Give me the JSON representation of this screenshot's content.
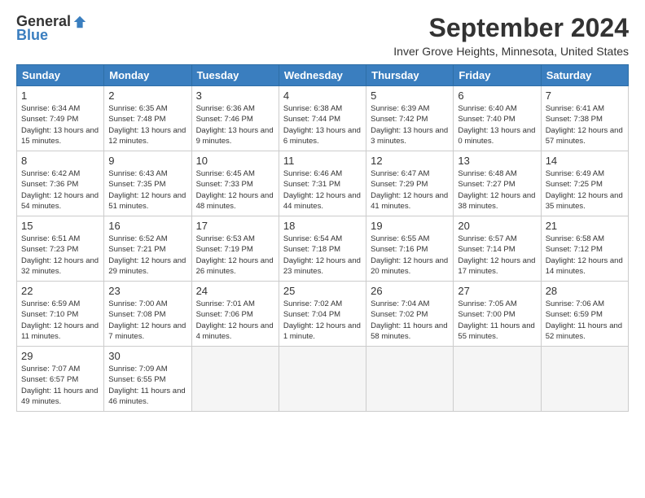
{
  "header": {
    "logo": {
      "general": "General",
      "blue": "Blue"
    },
    "title": "September 2024",
    "location": "Inver Grove Heights, Minnesota, United States"
  },
  "calendar": {
    "weekdays": [
      "Sunday",
      "Monday",
      "Tuesday",
      "Wednesday",
      "Thursday",
      "Friday",
      "Saturday"
    ],
    "weeks": [
      [
        {
          "day": "1",
          "sunrise": "Sunrise: 6:34 AM",
          "sunset": "Sunset: 7:49 PM",
          "daylight": "Daylight: 13 hours and 15 minutes."
        },
        {
          "day": "2",
          "sunrise": "Sunrise: 6:35 AM",
          "sunset": "Sunset: 7:48 PM",
          "daylight": "Daylight: 13 hours and 12 minutes."
        },
        {
          "day": "3",
          "sunrise": "Sunrise: 6:36 AM",
          "sunset": "Sunset: 7:46 PM",
          "daylight": "Daylight: 13 hours and 9 minutes."
        },
        {
          "day": "4",
          "sunrise": "Sunrise: 6:38 AM",
          "sunset": "Sunset: 7:44 PM",
          "daylight": "Daylight: 13 hours and 6 minutes."
        },
        {
          "day": "5",
          "sunrise": "Sunrise: 6:39 AM",
          "sunset": "Sunset: 7:42 PM",
          "daylight": "Daylight: 13 hours and 3 minutes."
        },
        {
          "day": "6",
          "sunrise": "Sunrise: 6:40 AM",
          "sunset": "Sunset: 7:40 PM",
          "daylight": "Daylight: 13 hours and 0 minutes."
        },
        {
          "day": "7",
          "sunrise": "Sunrise: 6:41 AM",
          "sunset": "Sunset: 7:38 PM",
          "daylight": "Daylight: 12 hours and 57 minutes."
        }
      ],
      [
        {
          "day": "8",
          "sunrise": "Sunrise: 6:42 AM",
          "sunset": "Sunset: 7:36 PM",
          "daylight": "Daylight: 12 hours and 54 minutes."
        },
        {
          "day": "9",
          "sunrise": "Sunrise: 6:43 AM",
          "sunset": "Sunset: 7:35 PM",
          "daylight": "Daylight: 12 hours and 51 minutes."
        },
        {
          "day": "10",
          "sunrise": "Sunrise: 6:45 AM",
          "sunset": "Sunset: 7:33 PM",
          "daylight": "Daylight: 12 hours and 48 minutes."
        },
        {
          "day": "11",
          "sunrise": "Sunrise: 6:46 AM",
          "sunset": "Sunset: 7:31 PM",
          "daylight": "Daylight: 12 hours and 44 minutes."
        },
        {
          "day": "12",
          "sunrise": "Sunrise: 6:47 AM",
          "sunset": "Sunset: 7:29 PM",
          "daylight": "Daylight: 12 hours and 41 minutes."
        },
        {
          "day": "13",
          "sunrise": "Sunrise: 6:48 AM",
          "sunset": "Sunset: 7:27 PM",
          "daylight": "Daylight: 12 hours and 38 minutes."
        },
        {
          "day": "14",
          "sunrise": "Sunrise: 6:49 AM",
          "sunset": "Sunset: 7:25 PM",
          "daylight": "Daylight: 12 hours and 35 minutes."
        }
      ],
      [
        {
          "day": "15",
          "sunrise": "Sunrise: 6:51 AM",
          "sunset": "Sunset: 7:23 PM",
          "daylight": "Daylight: 12 hours and 32 minutes."
        },
        {
          "day": "16",
          "sunrise": "Sunrise: 6:52 AM",
          "sunset": "Sunset: 7:21 PM",
          "daylight": "Daylight: 12 hours and 29 minutes."
        },
        {
          "day": "17",
          "sunrise": "Sunrise: 6:53 AM",
          "sunset": "Sunset: 7:19 PM",
          "daylight": "Daylight: 12 hours and 26 minutes."
        },
        {
          "day": "18",
          "sunrise": "Sunrise: 6:54 AM",
          "sunset": "Sunset: 7:18 PM",
          "daylight": "Daylight: 12 hours and 23 minutes."
        },
        {
          "day": "19",
          "sunrise": "Sunrise: 6:55 AM",
          "sunset": "Sunset: 7:16 PM",
          "daylight": "Daylight: 12 hours and 20 minutes."
        },
        {
          "day": "20",
          "sunrise": "Sunrise: 6:57 AM",
          "sunset": "Sunset: 7:14 PM",
          "daylight": "Daylight: 12 hours and 17 minutes."
        },
        {
          "day": "21",
          "sunrise": "Sunrise: 6:58 AM",
          "sunset": "Sunset: 7:12 PM",
          "daylight": "Daylight: 12 hours and 14 minutes."
        }
      ],
      [
        {
          "day": "22",
          "sunrise": "Sunrise: 6:59 AM",
          "sunset": "Sunset: 7:10 PM",
          "daylight": "Daylight: 12 hours and 11 minutes."
        },
        {
          "day": "23",
          "sunrise": "Sunrise: 7:00 AM",
          "sunset": "Sunset: 7:08 PM",
          "daylight": "Daylight: 12 hours and 7 minutes."
        },
        {
          "day": "24",
          "sunrise": "Sunrise: 7:01 AM",
          "sunset": "Sunset: 7:06 PM",
          "daylight": "Daylight: 12 hours and 4 minutes."
        },
        {
          "day": "25",
          "sunrise": "Sunrise: 7:02 AM",
          "sunset": "Sunset: 7:04 PM",
          "daylight": "Daylight: 12 hours and 1 minute."
        },
        {
          "day": "26",
          "sunrise": "Sunrise: 7:04 AM",
          "sunset": "Sunset: 7:02 PM",
          "daylight": "Daylight: 11 hours and 58 minutes."
        },
        {
          "day": "27",
          "sunrise": "Sunrise: 7:05 AM",
          "sunset": "Sunset: 7:00 PM",
          "daylight": "Daylight: 11 hours and 55 minutes."
        },
        {
          "day": "28",
          "sunrise": "Sunrise: 7:06 AM",
          "sunset": "Sunset: 6:59 PM",
          "daylight": "Daylight: 11 hours and 52 minutes."
        }
      ],
      [
        {
          "day": "29",
          "sunrise": "Sunrise: 7:07 AM",
          "sunset": "Sunset: 6:57 PM",
          "daylight": "Daylight: 11 hours and 49 minutes."
        },
        {
          "day": "30",
          "sunrise": "Sunrise: 7:09 AM",
          "sunset": "Sunset: 6:55 PM",
          "daylight": "Daylight: 11 hours and 46 minutes."
        },
        null,
        null,
        null,
        null,
        null
      ]
    ]
  }
}
